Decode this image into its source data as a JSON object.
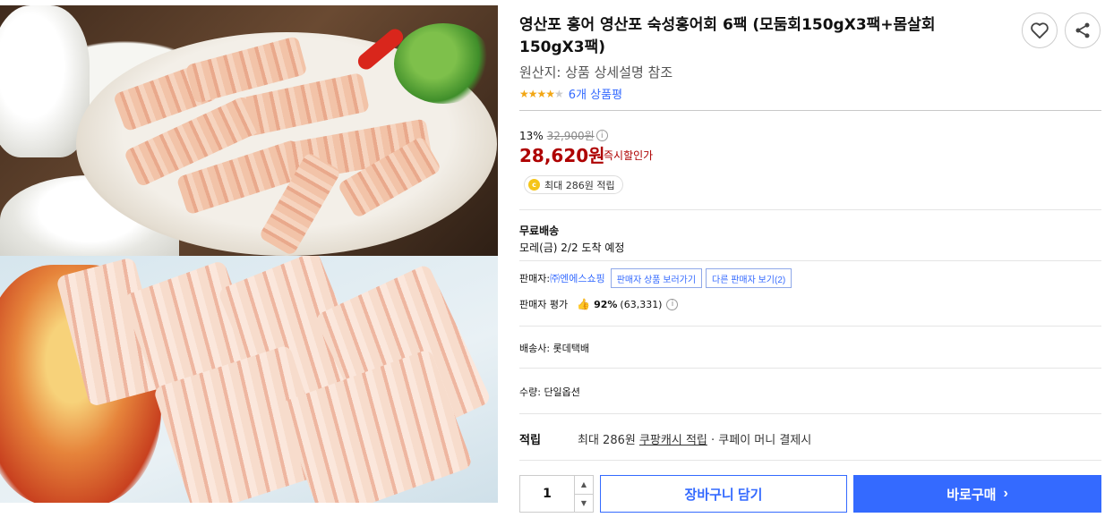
{
  "product": {
    "title": "영산포 홍어 영산포 숙성홍어회 6팩 (모둠회150gX3팩+몸살회 150gX3팩)",
    "origin": "원산지: 상품 상세설명 참조",
    "rating": {
      "stars": 4,
      "max": 5,
      "review_label": "6개 상품평"
    }
  },
  "icons": {
    "wish": "heart-icon",
    "share": "share-icon"
  },
  "price": {
    "discount_rate": "13%",
    "original_price": "32,900원",
    "sale_price": "28,620원",
    "sale_label": "즉시할인가",
    "reward_chip": "최대 286원 적립",
    "coin_symbol": "c"
  },
  "shipping": {
    "title": "무료배송",
    "arrival": "모레(금) 2/2 도착 예정"
  },
  "seller": {
    "label": "판매자:",
    "name": "㈜엔에스쇼핑",
    "view_products_button": "판매자 상품 보러가기",
    "other_sellers_button": "다른 판매자 보기(2)",
    "eval_label": "판매자 평가",
    "eval_percent": "92%",
    "eval_count": "(63,331)"
  },
  "carrier": "배송사: 롯데택배",
  "quantity_label": "수량: 단일옵션",
  "reward": {
    "title": "적립",
    "prefix": "최대 286원",
    "cash_link": "쿠팡캐시 적립",
    "suffix": "· 쿠페이 머니 결제시"
  },
  "purchase": {
    "quantity": "1",
    "cart_button": "장바구니 담기",
    "buy_button": "바로구매"
  },
  "colors": {
    "accent": "#346aff",
    "price_red": "#ae0000",
    "star": "#f2a614"
  }
}
